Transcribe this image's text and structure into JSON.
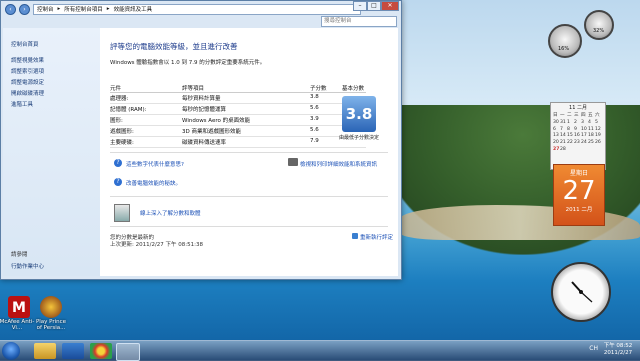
{
  "window": {
    "breadcrumb": [
      "控制台",
      "所有控制台項目",
      "效能資訊及工具"
    ],
    "search_placeholder": "搜尋控制台",
    "controls": {
      "min": "–",
      "max": "□",
      "close": "✕"
    }
  },
  "sidebar": {
    "top_items": [
      "控制台首頁",
      "調整視覺效果",
      "調整索引選項",
      "調整電源設定",
      "開啟磁碟清理",
      "進階工具"
    ],
    "bottom_heading": "請參閱",
    "bottom_items": [
      "行動作業中心"
    ]
  },
  "content": {
    "title": "評等您的電腦效能等級，並且進行改善",
    "note": "Windows 體驗指數會以 1.0 到 7.9 的分數評定重要系統元件。",
    "table_headers": [
      "元件",
      "評等項目",
      "子分數",
      "基本分數"
    ],
    "rows": [
      {
        "component": "處理器:",
        "rated": "每秒資料計算量",
        "subscore": "3.8"
      },
      {
        "component": "記憶體 (RAM):",
        "rated": "每秒的記憶體運算",
        "subscore": "5.6"
      },
      {
        "component": "圖形:",
        "rated": "Windows Aero 的桌面效能",
        "subscore": "3.9"
      },
      {
        "component": "遊戲圖形:",
        "rated": "3D 商業和遊戲圖形效能",
        "subscore": "5.6"
      },
      {
        "component": "主要硬碟:",
        "rated": "磁碟資料傳送速率",
        "subscore": "7.9"
      }
    ],
    "base_score": "3.8",
    "base_score_caption": "由最低子分數決定",
    "links": {
      "what_mean": "這些數字代表什麼意思?",
      "improve": "改善電腦效能的秘訣。",
      "print": "檢視和列印詳細效能和系統資訊",
      "learn_more": "線上深入了解分數和軟體"
    },
    "footer": {
      "current": "您的分數是最新的",
      "last_update": "上次更新: 2011/2/27 下午 08:51:38",
      "rerun": "重新執行評定"
    }
  },
  "desktop": {
    "icons": [
      {
        "label": "McAfee Anti-Vi...",
        "icon": "mcafee-icon"
      },
      {
        "label": "Play Prince of Persia...",
        "icon": "game-icon"
      }
    ]
  },
  "gadgets": {
    "cpu_percent": "16%",
    "mem_percent": "32%",
    "calendar_month": "11 二月",
    "calendar_days": [
      "日",
      "一",
      "二",
      "三",
      "四",
      "五",
      "六"
    ],
    "calendar_dates": [
      "30",
      "31",
      "1",
      "2",
      "3",
      "4",
      "5",
      "6",
      "7",
      "8",
      "9",
      "10",
      "11",
      "12",
      "13",
      "14",
      "15",
      "16",
      "17",
      "18",
      "19",
      "20",
      "21",
      "22",
      "23",
      "24",
      "25",
      "26",
      "27",
      "28"
    ],
    "day_name": "星期日",
    "day_number": "27",
    "month_year": "2011 二月"
  },
  "taskbar": {
    "lang": "CH",
    "time": "下午 08:52",
    "date": "2011/2/27"
  }
}
